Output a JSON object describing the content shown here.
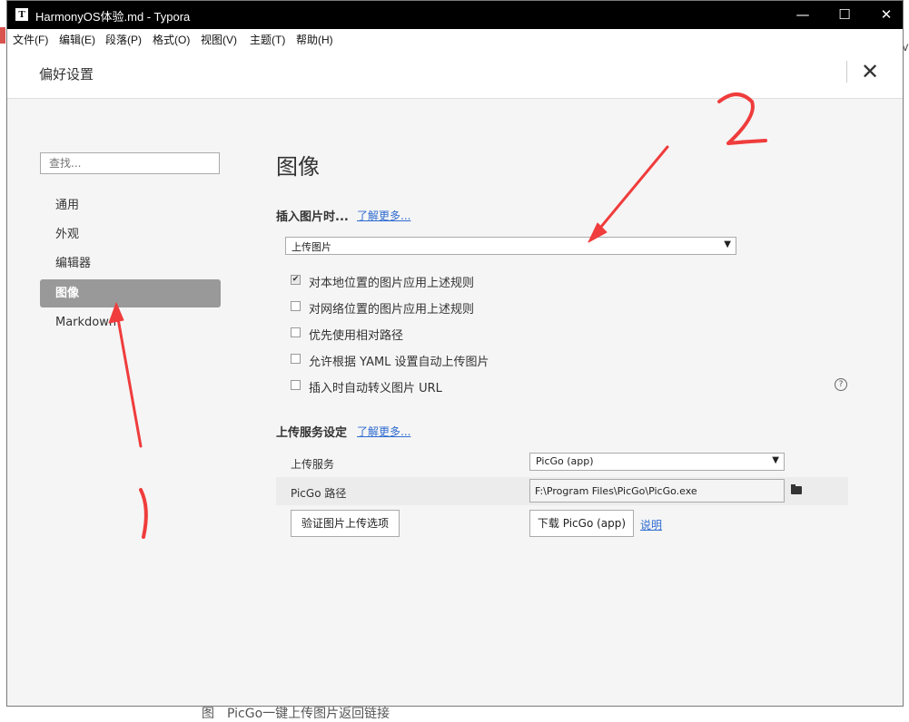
{
  "window": {
    "title": "HarmonyOS体验.md - Typora",
    "app_icon": "T",
    "controls": {
      "minimize": "—",
      "maximize": "☐",
      "close": "✕"
    }
  },
  "menu": [
    {
      "label": "文件(F)"
    },
    {
      "label": "编辑(E)"
    },
    {
      "label": "段落(P)"
    },
    {
      "label": "格式(O)"
    },
    {
      "label": "视图(V)"
    },
    {
      "label": "主题(T)"
    },
    {
      "label": "帮助(H)"
    }
  ],
  "preferences": {
    "title": "偏好设置",
    "close_icon": "✕"
  },
  "sidebar": {
    "search_placeholder": "查找...",
    "items": [
      {
        "label": "通用",
        "active": false
      },
      {
        "label": "外观",
        "active": false
      },
      {
        "label": "编辑器",
        "active": false
      },
      {
        "label": "图像",
        "active": true
      },
      {
        "label": "Markdown",
        "active": false
      }
    ]
  },
  "content": {
    "section_title": "图像",
    "insert_group": {
      "title": "插入图片时...",
      "learn_more": "了解更多...",
      "action_select": {
        "value": "上传图片",
        "caret": "▼"
      },
      "checkboxes": [
        {
          "label": "对本地位置的图片应用上述规则",
          "checked": true
        },
        {
          "label": "对网络位置的图片应用上述规则",
          "checked": false
        },
        {
          "label": "优先使用相对路径",
          "checked": false
        },
        {
          "label": "允许根据 YAML 设置自动上传图片",
          "checked": false
        },
        {
          "label": "插入时自动转义图片 URL",
          "checked": false
        }
      ],
      "help_icon": "?"
    },
    "upload_group": {
      "title": "上传服务设定",
      "learn_more": "了解更多...",
      "service_label": "上传服务",
      "service_value": "PicGo (app)",
      "path_label": "PicGo 路径",
      "path_value": "F:\\Program Files\\PicGo\\PicGo.exe",
      "verify_button": "验证图片上传选项",
      "download_button": "下载 PicGo (app)",
      "explain_link": "说明"
    }
  },
  "background": {
    "caption": "图　PicGo一键上传图片返回链接"
  },
  "colors": {
    "annotation": "#f03c3c",
    "link": "#2f6bd0",
    "active_item": "#999999"
  }
}
